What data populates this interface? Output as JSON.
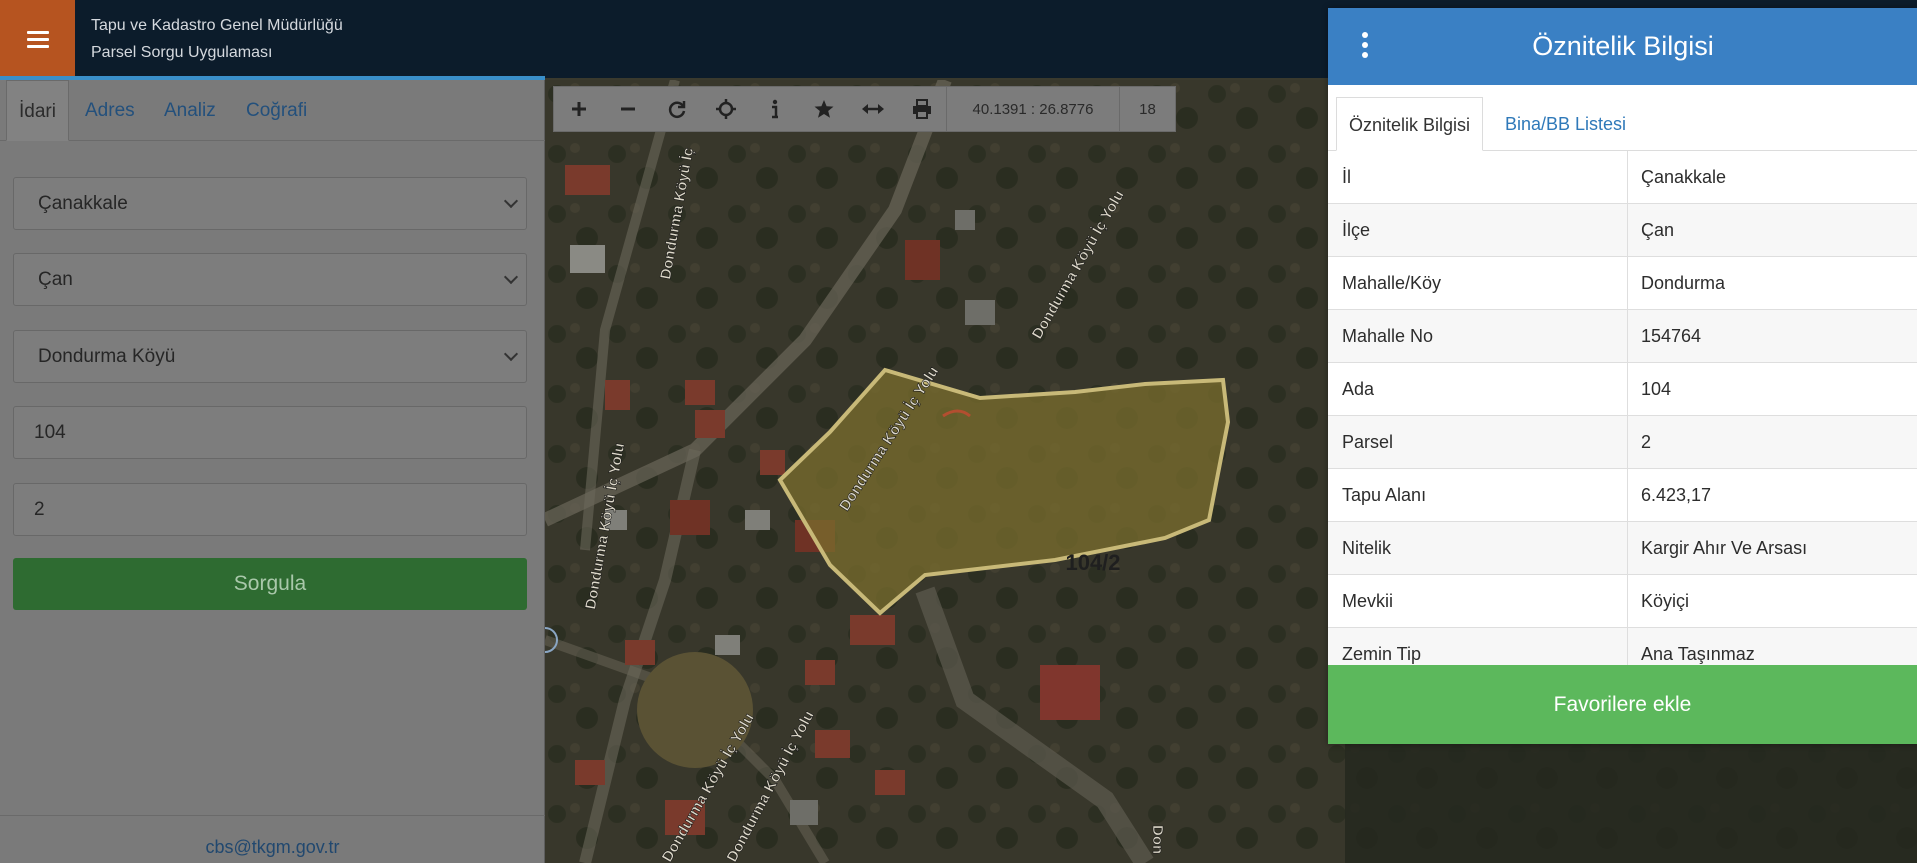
{
  "header": {
    "org_name": "Tapu ve Kadastro Genel Müdürlüğü",
    "app_name": "Parsel Sorgu Uygulaması",
    "menu_icon": "hamburger-icon"
  },
  "left_panel": {
    "tabs": [
      {
        "label": "İdari",
        "active": true
      },
      {
        "label": "Adres",
        "active": false
      },
      {
        "label": "Analiz",
        "active": false
      },
      {
        "label": "Coğrafi",
        "active": false
      }
    ],
    "province_select": "Çanakkale",
    "district_select": "Çan",
    "neighborhood_select": "Dondurma Köyü",
    "block_input": "104",
    "parcel_input": "2",
    "query_button": "Sorgula",
    "footer_email": "cbs@tkgm.gov.tr"
  },
  "map": {
    "toolbar": {
      "tools": [
        "zoom-in-icon",
        "zoom-out-icon",
        "refresh-icon",
        "locate-icon",
        "info-icon",
        "star-icon",
        "measure-icon",
        "print-icon"
      ],
      "coordinates": "40.1391 : 26.8776",
      "zoom_level": "18"
    },
    "parcel_label": "104/2",
    "road_labels": [
      "Dondurma Köyü İç",
      "Dondurma Köyü İç Yolu",
      "Dondurma Köyü İç Yolu",
      "Dondurma Köyü İç Yolu",
      "Dondurma Köyü İç Yolu",
      "Dondurma Köyü İç Yolu",
      "Don"
    ]
  },
  "attribute_panel": {
    "title": "Öznitelik Bilgisi",
    "tabs": [
      {
        "label": "Öznitelik Bilgisi",
        "active": true
      },
      {
        "label": "Bina/BB Listesi",
        "active": false
      }
    ],
    "rows": [
      {
        "key": "İl",
        "value": "Çanakkale"
      },
      {
        "key": "İlçe",
        "value": "Çan"
      },
      {
        "key": "Mahalle/Köy",
        "value": "Dondurma"
      },
      {
        "key": "Mahalle No",
        "value": "154764"
      },
      {
        "key": "Ada",
        "value": "104"
      },
      {
        "key": "Parsel",
        "value": "2"
      },
      {
        "key": "Tapu Alanı",
        "value": "6.423,17"
      },
      {
        "key": "Nitelik",
        "value": "Kargir Ahır Ve Arsası"
      },
      {
        "key": "Mevkii",
        "value": "Köyiçi"
      },
      {
        "key": "Zemin Tip",
        "value": "Ana Taşınmaz"
      }
    ],
    "favorite_button": "Favorilere ekle"
  }
}
